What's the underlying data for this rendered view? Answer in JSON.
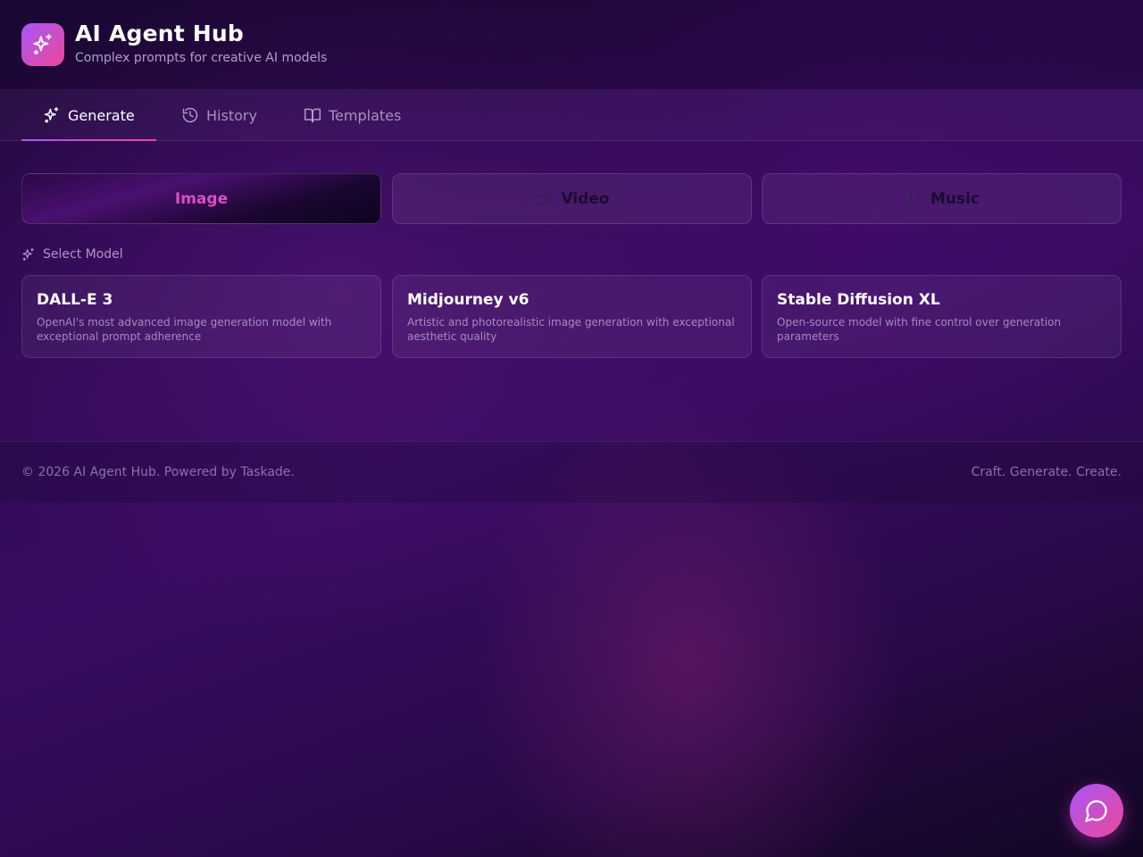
{
  "header": {
    "title": "AI Agent Hub",
    "subtitle": "Complex prompts for creative AI models",
    "logo_icon": "sparkles-icon"
  },
  "tabs": [
    {
      "label": "Generate",
      "icon": "sparkles-icon",
      "active": true
    },
    {
      "label": "History",
      "icon": "history-icon",
      "active": false
    },
    {
      "label": "Templates",
      "icon": "book-icon",
      "active": false
    }
  ],
  "media_types": [
    {
      "label": "Image",
      "active": true
    },
    {
      "label": "Video",
      "icon": "video-icon",
      "active": false
    },
    {
      "label": "Music",
      "icon": "music-icon",
      "active": false
    }
  ],
  "model_section": {
    "label": "Select Model",
    "icon": "sparkles-icon"
  },
  "models": [
    {
      "name": "DALL-E 3",
      "description": "OpenAI's most advanced image generation model with exceptional prompt adherence"
    },
    {
      "name": "Midjourney v6",
      "description": "Artistic and photorealistic image generation with exceptional aesthetic quality"
    },
    {
      "name": "Stable Diffusion XL",
      "description": "Open-source model with fine control over generation parameters"
    }
  ],
  "footer": {
    "left": "© 2026 AI Agent Hub. Powered by Taskade.",
    "right": "Craft. Generate. Create."
  },
  "chat_button": {
    "icon": "chat-bubble-icon"
  },
  "colors": {
    "accent_start": "#a855f7",
    "accent_end": "#ec4899",
    "active_media_text": "#d84fc4"
  }
}
